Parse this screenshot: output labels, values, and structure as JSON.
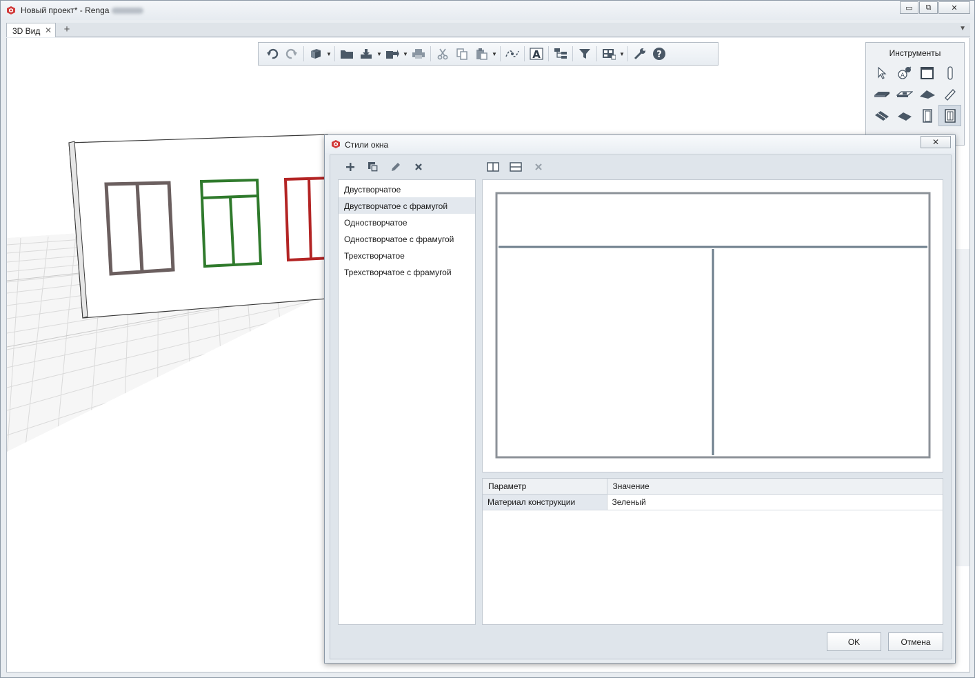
{
  "app": {
    "title": "Новый проект* - Renga",
    "controls": {
      "minimize": "▭",
      "restore": "⧉",
      "close": "✕"
    }
  },
  "tabs": [
    {
      "label": "3D Вид",
      "close": "✕"
    }
  ],
  "tab_add": "+",
  "tab_menu": "▼",
  "tools_panel": {
    "title": "Инструменты",
    "tools": [
      "select-icon",
      "axis-icon",
      "wall-icon",
      "column-icon",
      "floor-icon",
      "opening-icon",
      "roof-icon",
      "beam-icon",
      "stair-icon",
      "ramp-icon",
      "door-icon",
      "window-icon"
    ]
  },
  "dialog": {
    "title": "Стили окна",
    "close": "✕",
    "styles": [
      "Двустворчатое",
      "Двустворчатое с фрамугой",
      "Одностворчатое",
      "Одностворчатое с фрамугой",
      "Трехстворчатое",
      "Трехстворчатое с фрамугой"
    ],
    "selected_style": "Двустворчатое с фрамугой",
    "params_header": {
      "param": "Параметр",
      "value": "Значение"
    },
    "params": [
      {
        "name": "Материал конструкции",
        "value": "Зеленый"
      }
    ],
    "ok": "OK",
    "cancel": "Отмена"
  },
  "colors": {
    "frame_brown": "#6b5f5f",
    "frame_green": "#2f7a2c",
    "frame_red": "#b32424",
    "preview_line": "#6e7f8c"
  }
}
